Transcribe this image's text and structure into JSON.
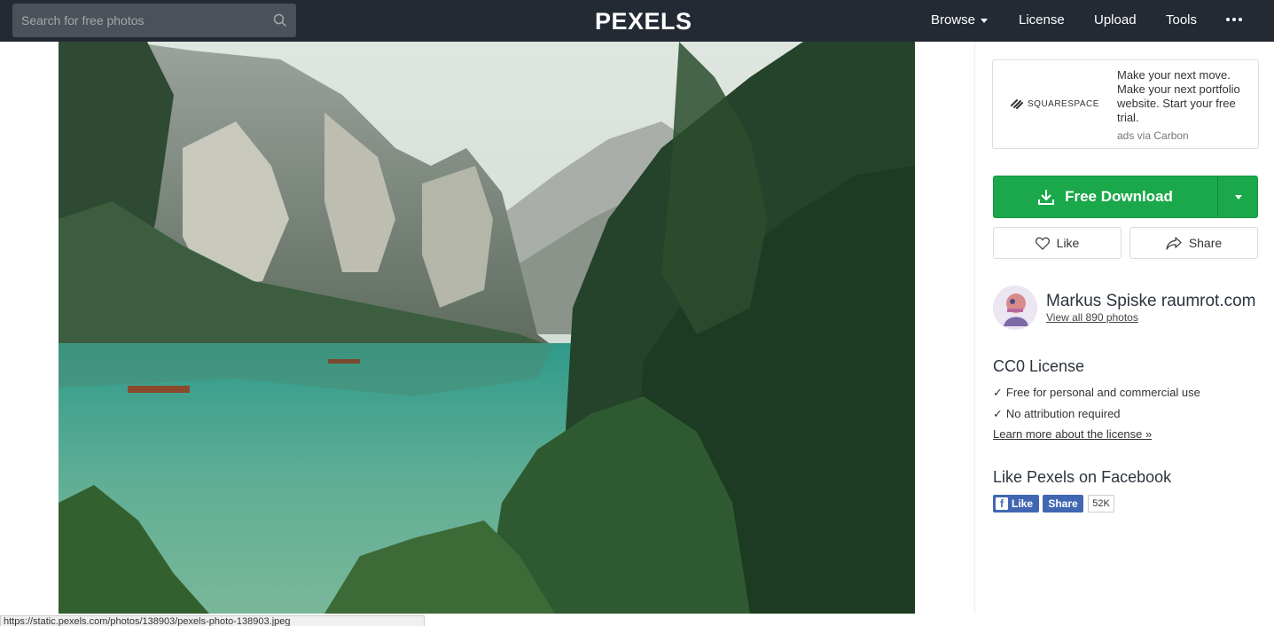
{
  "header": {
    "search_placeholder": "Search for free photos",
    "logo": "PEXELS",
    "nav": {
      "browse": "Browse",
      "license": "License",
      "upload": "Upload",
      "tools": "Tools"
    }
  },
  "ad": {
    "brand": "SQUARESPACE",
    "text": "Make your next move. Make your next portfolio website. Start your free trial.",
    "via": "ads via Carbon"
  },
  "actions": {
    "download_label": "Free Download",
    "like_label": "Like",
    "share_label": "Share"
  },
  "author": {
    "name": "Markus Spiske raumrot.com",
    "view_all": "View all 890 photos"
  },
  "license": {
    "title": "CC0 License",
    "items": [
      "Free for personal and commercial use",
      "No attribution required"
    ],
    "tick": "✓",
    "learn_more": "Learn more about the license »"
  },
  "facebook": {
    "title": "Like Pexels on Facebook",
    "like_label": "Like",
    "share_label": "Share",
    "count": "52K"
  },
  "status_url": "https://static.pexels.com/photos/138903/pexels-photo-138903.jpeg",
  "colors": {
    "topbar": "#232a34",
    "download_green": "#1aa84a",
    "facebook_blue": "#4267b2"
  }
}
